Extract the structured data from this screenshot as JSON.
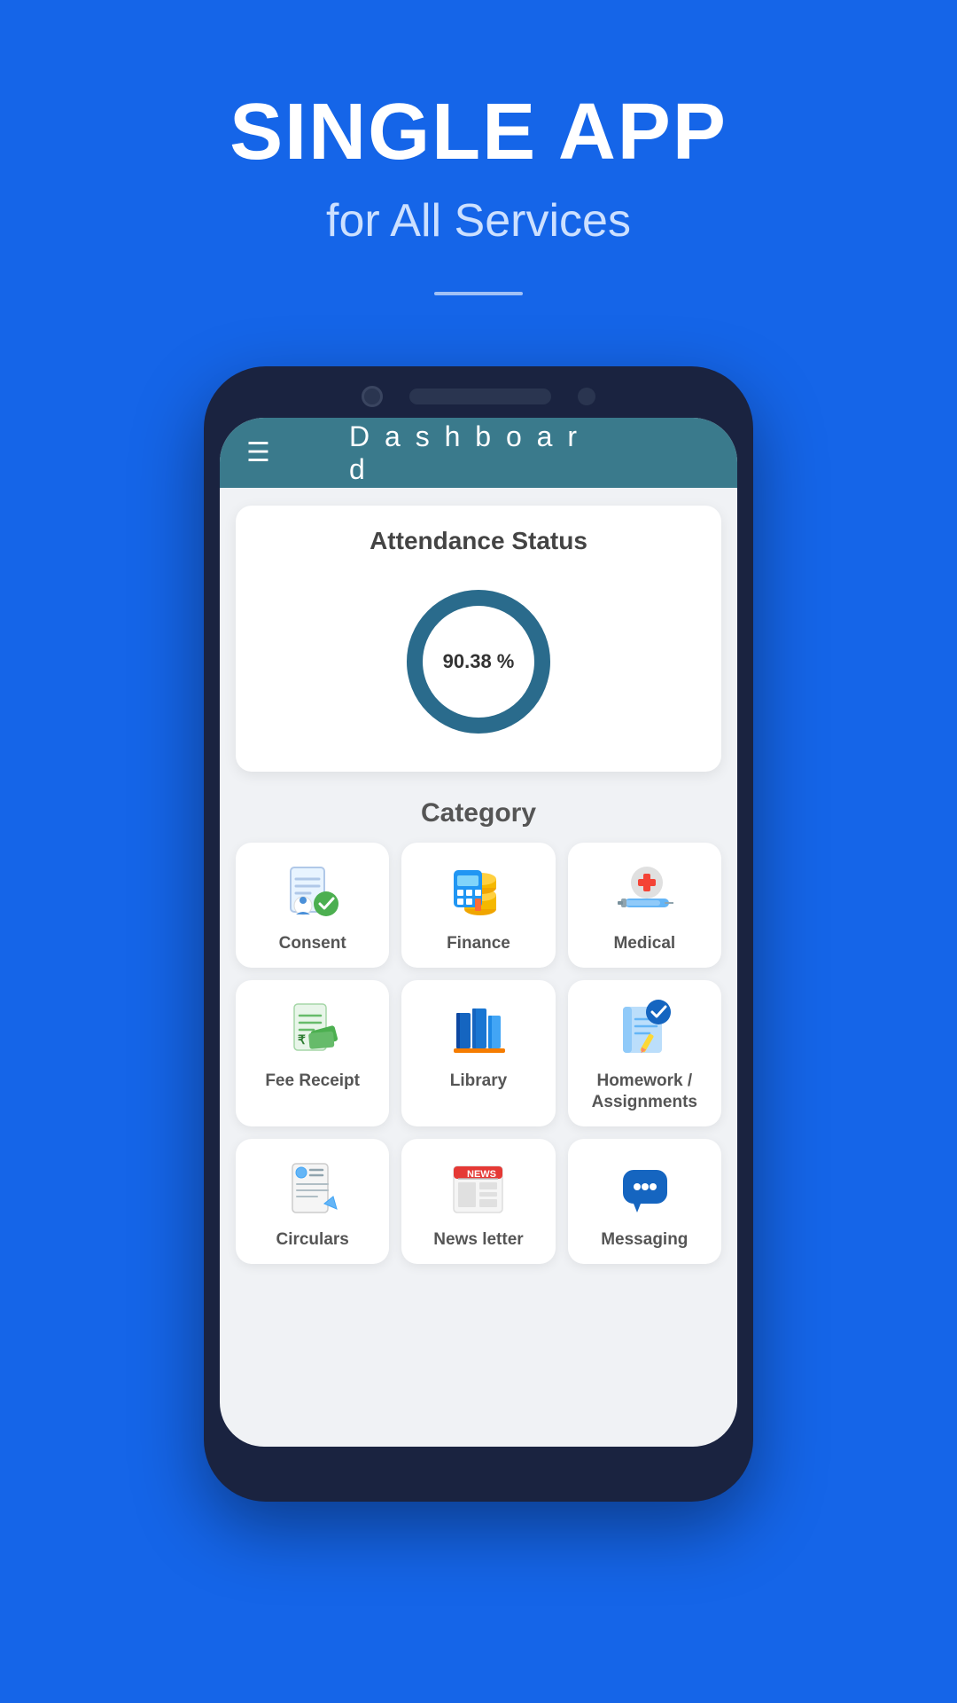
{
  "hero": {
    "title": "SINGLE APP",
    "subtitle": "for All Services"
  },
  "dashboard": {
    "header_title": "D a s h b o a r d",
    "attendance": {
      "section_title": "Attendance Status",
      "percentage": "90.38 %"
    },
    "category": {
      "section_title": "Category",
      "items": [
        {
          "id": "consent",
          "label": "Consent",
          "icon": "consent"
        },
        {
          "id": "finance",
          "label": "Finance",
          "icon": "finance"
        },
        {
          "id": "medical",
          "label": "Medical",
          "icon": "medical"
        },
        {
          "id": "fee-receipt",
          "label": "Fee Receipt",
          "icon": "fee-receipt"
        },
        {
          "id": "library",
          "label": "Library",
          "icon": "library"
        },
        {
          "id": "homework",
          "label": "Homework / Assignments",
          "icon": "homework"
        },
        {
          "id": "circulars",
          "label": "Circulars",
          "icon": "circulars"
        },
        {
          "id": "newsletter",
          "label": "News letter",
          "icon": "newsletter"
        },
        {
          "id": "messaging",
          "label": "Messaging",
          "icon": "messaging"
        }
      ]
    }
  }
}
